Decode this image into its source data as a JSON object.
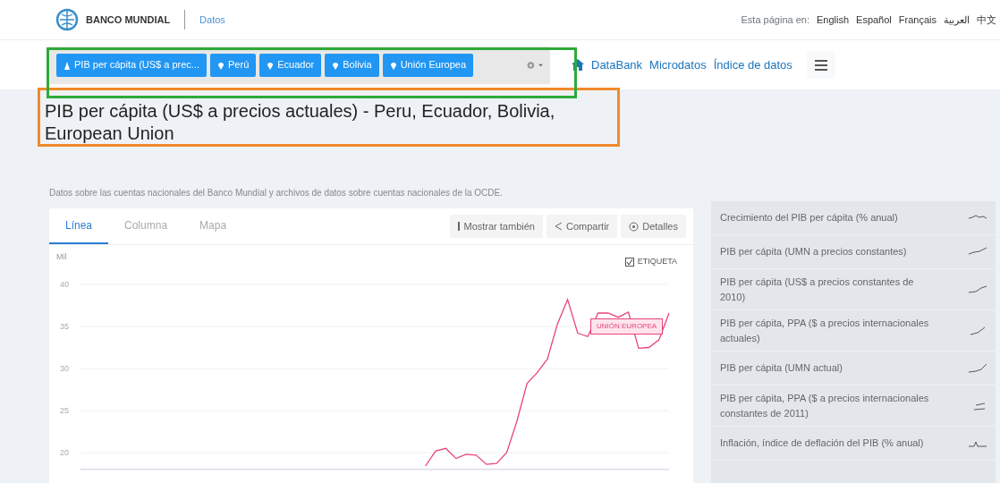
{
  "header": {
    "logo": "BANCO MUNDIAL",
    "section": "Datos",
    "language_label": "Esta página en:",
    "languages": [
      "English",
      "Español",
      "Français",
      "العربية",
      "中文"
    ]
  },
  "filters": [
    {
      "kind": "indicator",
      "label": "PIB per cápita (US$ a prec..."
    },
    {
      "kind": "place",
      "label": "Perú"
    },
    {
      "kind": "place",
      "label": "Ecuador"
    },
    {
      "kind": "place",
      "label": "Bolivia"
    },
    {
      "kind": "place",
      "label": "Unión Europea"
    }
  ],
  "nav": [
    "DataBank",
    "Microdatos",
    "Índice de datos"
  ],
  "title": "PIB per cápita (US$ a precios actuales) - Peru, Ecuador, Bolivia, European Union",
  "subtitle": "Datos sobre las cuentas nacionales del Banco Mundial y archivos de datos sobre cuentas nacionales de la OCDE.",
  "tabs": [
    {
      "label": "Línea",
      "selected": true
    },
    {
      "label": "Columna",
      "selected": false
    },
    {
      "label": "Mapa",
      "selected": false
    }
  ],
  "actions": [
    {
      "kind": "more",
      "label": "Mostrar también"
    },
    {
      "kind": "share",
      "label": "Compartir"
    },
    {
      "kind": "details",
      "label": "Detalles"
    }
  ],
  "label_toggle": {
    "label": "ETIQUETA",
    "checked": true
  },
  "chart": {
    "chart_data": {
      "type": "line",
      "ylabel": "Mil",
      "yticks": [
        20,
        25,
        30,
        35,
        40
      ],
      "ylim": [
        18,
        40
      ],
      "grid": true,
      "series": [
        {
          "name": "UNIÓN EUROPEA",
          "color": "#e8457a",
          "values": [
            null,
            null,
            null,
            null,
            null,
            null,
            null,
            null,
            null,
            null,
            null,
            null,
            null,
            null,
            null,
            null,
            null,
            null,
            null,
            null,
            null,
            null,
            null,
            null,
            null,
            null,
            null,
            null,
            null,
            null,
            null,
            null,
            null,
            null,
            18.4,
            20.2,
            20.5,
            19.3,
            19.8,
            19.7,
            18.6,
            18.7,
            20.0,
            23.7,
            28.2,
            29.5,
            31.1,
            35.3,
            38.2,
            34.2,
            33.8,
            36.6,
            36.6,
            36.1,
            36.7,
            32.4,
            32.5,
            33.4,
            36.6
          ]
        }
      ]
    }
  },
  "related": [
    "Crecimiento del PIB per cápita (% anual)",
    "PIB per cápita (UMN a precios constantes)",
    "PIB per cápita (US$ a precios constantes de 2010)",
    "PIB per cápita, PPA ($ a precios internacionales actuales)",
    "PIB per cápita (UMN actual)",
    "PIB per cápita, PPA ($ a precios internacionales constantes de 2011)",
    "Inflación, índice de deflación del PIB (% anual)"
  ]
}
